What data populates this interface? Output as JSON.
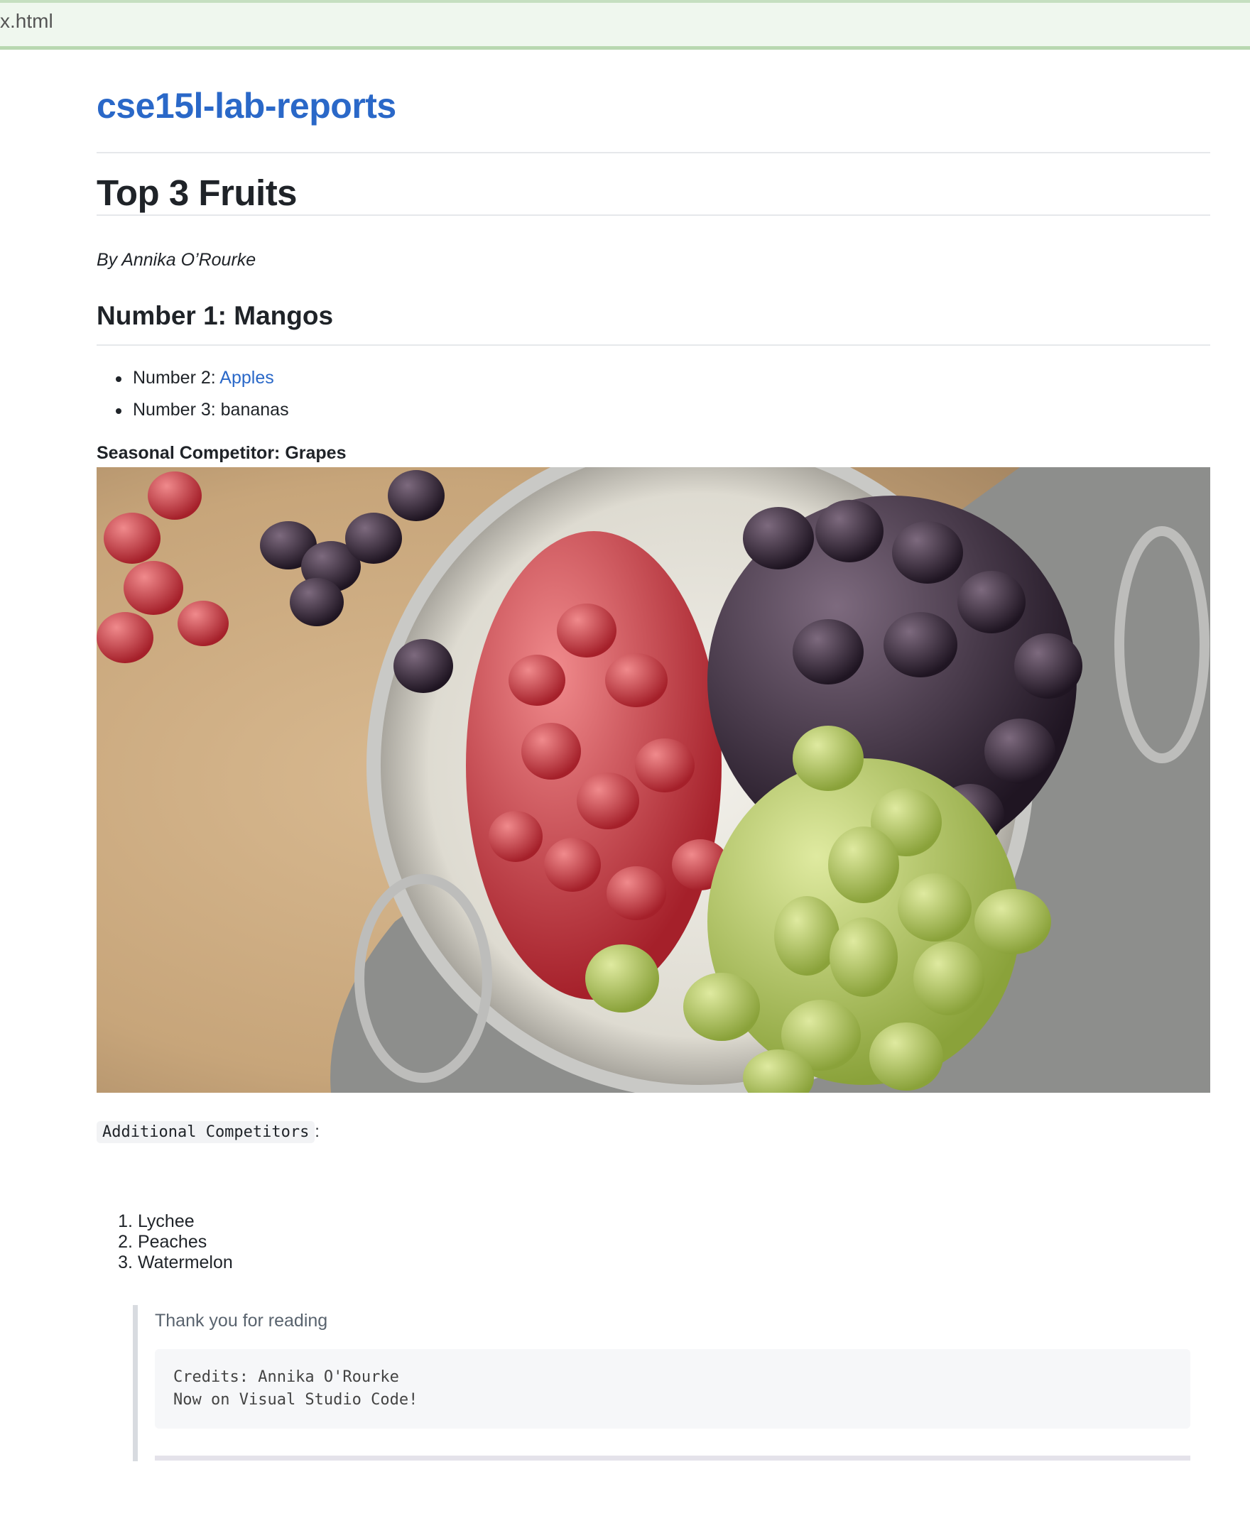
{
  "browser": {
    "url": "x.html"
  },
  "site": {
    "title": "cse15l-lab-reports"
  },
  "article": {
    "title": "Top 3 Fruits",
    "byline": "By Annika O’Rourke",
    "heading_number1": "Number 1: Mangos",
    "bullets": [
      {
        "prefix": "Number 2: ",
        "link_text": "Apples"
      },
      {
        "text": "Number 3: bananas"
      }
    ],
    "seasonal": "Seasonal Competitor: Grapes",
    "image": {
      "subject": "grapes in a colander"
    },
    "additional_code": "Additional Competitors",
    "additional_suffix": ":",
    "competitors": [
      {
        "num": "1.",
        "label": "Lychee"
      },
      {
        "num": "2.",
        "label": "Peaches"
      },
      {
        "num": "3.",
        "label": "Watermelon"
      }
    ],
    "quote_text": "Thank you for reading",
    "code_lines": [
      "Credits: Annika O'Rourke",
      "Now on Visual Studio Code!"
    ]
  },
  "colors": {
    "link": "#2a68c8",
    "text": "#1f2328",
    "urlbar": "#eff7ee"
  }
}
